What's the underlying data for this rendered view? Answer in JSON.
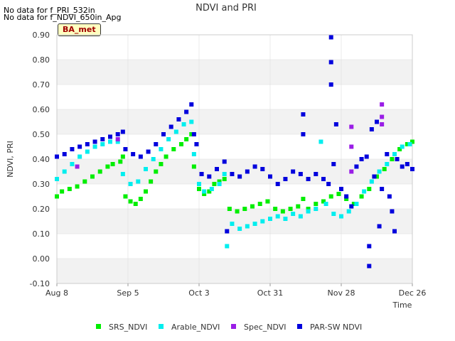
{
  "notes": [
    "No data for f_PRI_532in",
    "No data for f_NDVI_650in_Apg"
  ],
  "badge": "BA_met",
  "colors": {
    "SRS_NDVI": "#00ee00",
    "Arable_NDVI": "#00eeee",
    "Spec_NDVI": "#9a1ee6",
    "PAR-SW NDVI": "#0000dd",
    "band": "#f2f2f2",
    "grid": "#dddddd"
  },
  "chart_data": {
    "type": "scatter",
    "title": "NDVI and PRI",
    "xlabel": "Time",
    "ylabel": "NDVI, PRI",
    "xlim": [
      "2023-08-08",
      "2023-12-26"
    ],
    "ylim": [
      -0.1,
      0.9
    ],
    "x_tick_labels": [
      "Aug 8",
      "Sep 5",
      "Oct 3",
      "Oct 31",
      "Nov 28",
      "Dec 26"
    ],
    "y_tick_labels": [
      "-0.10",
      "0.00",
      "0.10",
      "0.20",
      "0.30",
      "0.40",
      "0.50",
      "0.60",
      "0.70",
      "0.80",
      "0.90"
    ],
    "grid": true,
    "legend_position": "bottom",
    "series": [
      {
        "name": "SRS_NDVI",
        "points": [
          [
            "2023-08-08",
            0.25
          ],
          [
            "2023-08-10",
            0.27
          ],
          [
            "2023-08-13",
            0.28
          ],
          [
            "2023-08-16",
            0.29
          ],
          [
            "2023-08-19",
            0.31
          ],
          [
            "2023-08-22",
            0.33
          ],
          [
            "2023-08-25",
            0.35
          ],
          [
            "2023-08-28",
            0.37
          ],
          [
            "2023-08-30",
            0.38
          ],
          [
            "2023-09-02",
            0.39
          ],
          [
            "2023-09-03",
            0.41
          ],
          [
            "2023-09-04",
            0.25
          ],
          [
            "2023-09-06",
            0.23
          ],
          [
            "2023-09-08",
            0.22
          ],
          [
            "2023-09-10",
            0.24
          ],
          [
            "2023-09-12",
            0.27
          ],
          [
            "2023-09-14",
            0.31
          ],
          [
            "2023-09-16",
            0.35
          ],
          [
            "2023-09-18",
            0.38
          ],
          [
            "2023-09-20",
            0.41
          ],
          [
            "2023-09-23",
            0.44
          ],
          [
            "2023-09-26",
            0.46
          ],
          [
            "2023-09-28",
            0.48
          ],
          [
            "2023-09-30",
            0.5
          ],
          [
            "2023-10-01",
            0.37
          ],
          [
            "2023-10-03",
            0.28
          ],
          [
            "2023-10-05",
            0.26
          ],
          [
            "2023-10-07",
            0.27
          ],
          [
            "2023-10-09",
            0.3
          ],
          [
            "2023-10-11",
            0.31
          ],
          [
            "2023-10-13",
            0.32
          ],
          [
            "2023-10-15",
            0.2
          ],
          [
            "2023-10-18",
            0.19
          ],
          [
            "2023-10-21",
            0.2
          ],
          [
            "2023-10-24",
            0.21
          ],
          [
            "2023-10-27",
            0.22
          ],
          [
            "2023-10-30",
            0.23
          ],
          [
            "2023-11-02",
            0.2
          ],
          [
            "2023-11-05",
            0.19
          ],
          [
            "2023-11-08",
            0.2
          ],
          [
            "2023-11-11",
            0.21
          ],
          [
            "2023-11-13",
            0.24
          ],
          [
            "2023-11-15",
            0.2
          ],
          [
            "2023-11-18",
            0.22
          ],
          [
            "2023-11-21",
            0.23
          ],
          [
            "2023-11-24",
            0.25
          ],
          [
            "2023-11-27",
            0.26
          ],
          [
            "2023-11-30",
            0.24
          ],
          [
            "2023-12-03",
            0.22
          ],
          [
            "2023-12-06",
            0.25
          ],
          [
            "2023-12-09",
            0.28
          ],
          [
            "2023-12-12",
            0.33
          ],
          [
            "2023-12-15",
            0.36
          ],
          [
            "2023-12-18",
            0.4
          ],
          [
            "2023-12-21",
            0.44
          ],
          [
            "2023-12-24",
            0.46
          ],
          [
            "2023-12-26",
            0.47
          ]
        ]
      },
      {
        "name": "Arable_NDVI",
        "points": [
          [
            "2023-08-08",
            0.32
          ],
          [
            "2023-08-11",
            0.35
          ],
          [
            "2023-08-14",
            0.38
          ],
          [
            "2023-08-17",
            0.41
          ],
          [
            "2023-08-20",
            0.43
          ],
          [
            "2023-08-23",
            0.45
          ],
          [
            "2023-08-26",
            0.46
          ],
          [
            "2023-08-29",
            0.47
          ],
          [
            "2023-09-01",
            0.47
          ],
          [
            "2023-09-03",
            0.34
          ],
          [
            "2023-09-06",
            0.3
          ],
          [
            "2023-09-09",
            0.31
          ],
          [
            "2023-09-12",
            0.36
          ],
          [
            "2023-09-15",
            0.4
          ],
          [
            "2023-09-18",
            0.44
          ],
          [
            "2023-09-21",
            0.48
          ],
          [
            "2023-09-24",
            0.51
          ],
          [
            "2023-09-27",
            0.54
          ],
          [
            "2023-09-30",
            0.55
          ],
          [
            "2023-10-01",
            0.42
          ],
          [
            "2023-10-03",
            0.3
          ],
          [
            "2023-10-05",
            0.27
          ],
          [
            "2023-10-08",
            0.28
          ],
          [
            "2023-10-11",
            0.3
          ],
          [
            "2023-10-13",
            0.34
          ],
          [
            "2023-10-14",
            0.05
          ],
          [
            "2023-10-16",
            0.14
          ],
          [
            "2023-10-19",
            0.12
          ],
          [
            "2023-10-22",
            0.13
          ],
          [
            "2023-10-25",
            0.14
          ],
          [
            "2023-10-28",
            0.15
          ],
          [
            "2023-10-31",
            0.16
          ],
          [
            "2023-11-03",
            0.17
          ],
          [
            "2023-11-06",
            0.16
          ],
          [
            "2023-11-09",
            0.18
          ],
          [
            "2023-11-12",
            0.17
          ],
          [
            "2023-11-15",
            0.19
          ],
          [
            "2023-11-18",
            0.2
          ],
          [
            "2023-11-20",
            0.47
          ],
          [
            "2023-11-22",
            0.22
          ],
          [
            "2023-11-25",
            0.18
          ],
          [
            "2023-11-28",
            0.17
          ],
          [
            "2023-12-01",
            0.19
          ],
          [
            "2023-12-04",
            0.22
          ],
          [
            "2023-12-07",
            0.27
          ],
          [
            "2023-12-10",
            0.31
          ],
          [
            "2023-12-13",
            0.35
          ],
          [
            "2023-12-16",
            0.38
          ],
          [
            "2023-12-19",
            0.42
          ],
          [
            "2023-12-22",
            0.45
          ],
          [
            "2023-12-25",
            0.46
          ]
        ]
      },
      {
        "name": "Spec_NDVI",
        "points": [
          [
            "2023-08-16",
            0.37
          ],
          [
            "2023-09-01",
            0.48
          ],
          [
            "2023-12-02",
            0.53
          ],
          [
            "2023-12-02",
            0.45
          ],
          [
            "2023-12-02",
            0.35
          ],
          [
            "2023-12-14",
            0.62
          ],
          [
            "2023-12-14",
            0.57
          ],
          [
            "2023-12-14",
            0.54
          ]
        ]
      },
      {
        "name": "PAR-SW NDVI",
        "points": [
          [
            "2023-08-08",
            0.41
          ],
          [
            "2023-08-11",
            0.42
          ],
          [
            "2023-08-14",
            0.44
          ],
          [
            "2023-08-17",
            0.45
          ],
          [
            "2023-08-20",
            0.46
          ],
          [
            "2023-08-23",
            0.47
          ],
          [
            "2023-08-26",
            0.48
          ],
          [
            "2023-08-29",
            0.49
          ],
          [
            "2023-09-01",
            0.5
          ],
          [
            "2023-09-03",
            0.51
          ],
          [
            "2023-09-04",
            0.44
          ],
          [
            "2023-09-07",
            0.42
          ],
          [
            "2023-09-10",
            0.41
          ],
          [
            "2023-09-13",
            0.43
          ],
          [
            "2023-09-16",
            0.46
          ],
          [
            "2023-09-19",
            0.5
          ],
          [
            "2023-09-22",
            0.53
          ],
          [
            "2023-09-25",
            0.56
          ],
          [
            "2023-09-28",
            0.59
          ],
          [
            "2023-09-30",
            0.62
          ],
          [
            "2023-10-01",
            0.5
          ],
          [
            "2023-10-02",
            0.46
          ],
          [
            "2023-10-04",
            0.34
          ],
          [
            "2023-10-07",
            0.33
          ],
          [
            "2023-10-10",
            0.36
          ],
          [
            "2023-10-13",
            0.39
          ],
          [
            "2023-10-14",
            0.11
          ],
          [
            "2023-10-16",
            0.34
          ],
          [
            "2023-10-19",
            0.33
          ],
          [
            "2023-10-22",
            0.35
          ],
          [
            "2023-10-25",
            0.37
          ],
          [
            "2023-10-28",
            0.36
          ],
          [
            "2023-10-31",
            0.33
          ],
          [
            "2023-11-03",
            0.3
          ],
          [
            "2023-11-06",
            0.32
          ],
          [
            "2023-11-09",
            0.35
          ],
          [
            "2023-11-12",
            0.34
          ],
          [
            "2023-11-13",
            0.58
          ],
          [
            "2023-11-13",
            0.5
          ],
          [
            "2023-11-15",
            0.32
          ],
          [
            "2023-11-18",
            0.34
          ],
          [
            "2023-11-21",
            0.32
          ],
          [
            "2023-11-23",
            0.3
          ],
          [
            "2023-11-24",
            0.89
          ],
          [
            "2023-11-24",
            0.79
          ],
          [
            "2023-11-24",
            0.7
          ],
          [
            "2023-11-25",
            0.38
          ],
          [
            "2023-11-26",
            0.54
          ],
          [
            "2023-11-28",
            0.28
          ],
          [
            "2023-11-30",
            0.25
          ],
          [
            "2023-12-02",
            0.21
          ],
          [
            "2023-12-04",
            0.37
          ],
          [
            "2023-12-06",
            0.4
          ],
          [
            "2023-12-08",
            0.41
          ],
          [
            "2023-12-09",
            0.05
          ],
          [
            "2023-12-09",
            -0.03
          ],
          [
            "2023-12-10",
            0.52
          ],
          [
            "2023-12-11",
            0.33
          ],
          [
            "2023-12-12",
            0.55
          ],
          [
            "2023-12-13",
            0.13
          ],
          [
            "2023-12-14",
            0.28
          ],
          [
            "2023-12-16",
            0.42
          ],
          [
            "2023-12-17",
            0.25
          ],
          [
            "2023-12-18",
            0.19
          ],
          [
            "2023-12-19",
            0.11
          ],
          [
            "2023-12-20",
            0.4
          ],
          [
            "2023-12-22",
            0.37
          ],
          [
            "2023-12-24",
            0.38
          ],
          [
            "2023-12-26",
            0.36
          ]
        ]
      }
    ]
  }
}
